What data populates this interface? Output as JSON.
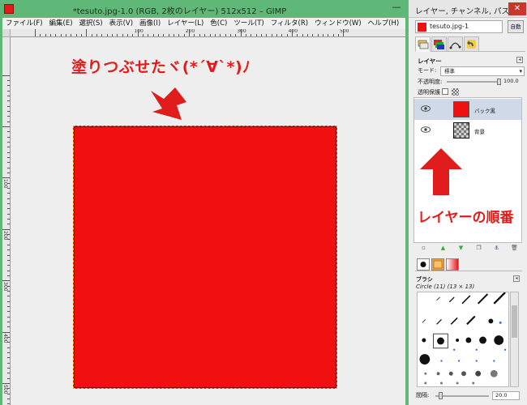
{
  "main_window": {
    "title": "*tesuto.jpg-1.0 (RGB, 2枚のレイヤー) 512x512 – GIMP",
    "minimize_glyph": "—",
    "menu": [
      "ファイル(F)",
      "編集(E)",
      "選択(S)",
      "表示(V)",
      "画像(I)",
      "レイヤー(L)",
      "色(C)",
      "ツール(T)",
      "フィルタ(R)",
      "ウィンドウ(W)",
      "ヘルプ(H)"
    ],
    "ruler_h_labels": [
      "100",
      "200",
      "300",
      "400",
      "500"
    ],
    "ruler_v_labels": [
      "100",
      "200",
      "300",
      "400",
      "500"
    ],
    "annotation_top": "塗りつぶせたヾ(*´∀`*)ﾉ"
  },
  "dock": {
    "title": "レイヤー, チャンネル, パス, ア…",
    "close_glyph": "✕",
    "image_selector": "tesuto.jpg-1",
    "auto_label": "自動",
    "layers": {
      "heading": "レイヤー",
      "mode_label": "モード:",
      "mode_value": "標準",
      "opacity_label": "不透明度:",
      "opacity_value": "100.0",
      "lock_label": "透明保護",
      "items": [
        {
          "name": "バック黒",
          "thumb": "red"
        },
        {
          "name": "背景",
          "thumb": "checker"
        }
      ]
    },
    "annotation_right": "レイヤーの順番",
    "brushes": {
      "heading": "ブラシ",
      "selected_name": "Circle (11) (13 × 13)",
      "spacing_label": "間隔:",
      "spacing_value": "20.0"
    }
  },
  "colors": {
    "window_green": "#5fb877",
    "image_red": "#f01010",
    "annotation_red": "#e01c1c"
  }
}
